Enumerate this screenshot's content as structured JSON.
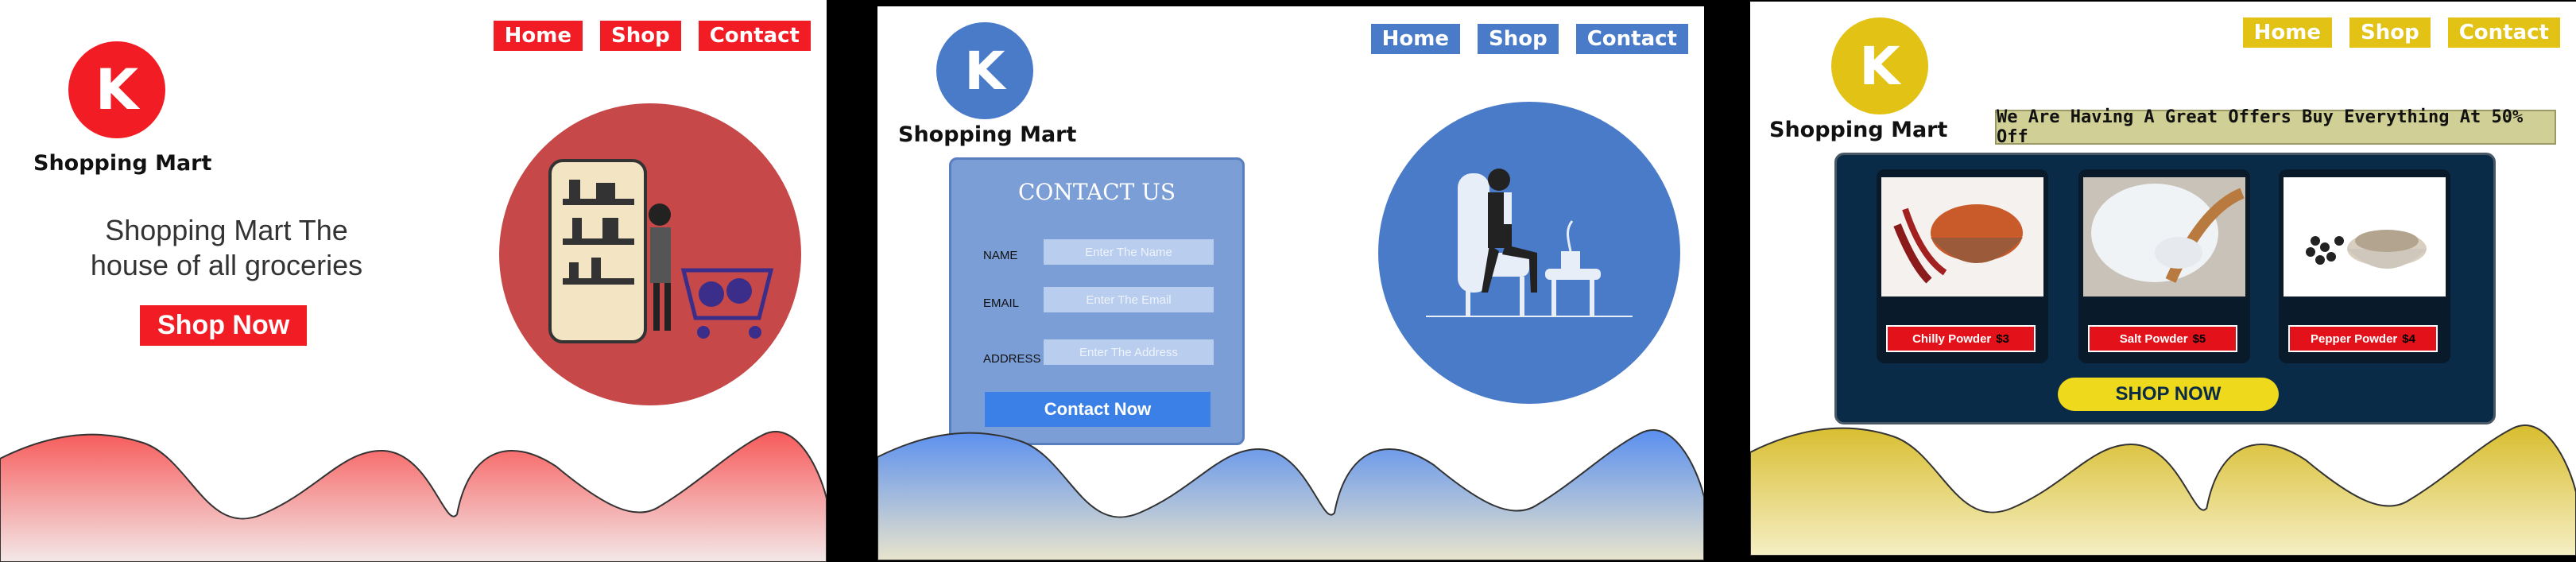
{
  "panels": [
    {
      "nav": [
        "Home",
        "Shop",
        "Contact"
      ],
      "logo_letter": "K",
      "brand": "Shopping Mart",
      "headline_line1": "Shopping Mart The",
      "headline_line2": "house of all groceries",
      "cta": "Shop Now",
      "accent": "#f21c24"
    },
    {
      "nav": [
        "Home",
        "Shop",
        "Contact"
      ],
      "logo_letter": "K",
      "brand": "Shopping Mart",
      "contact_title": "CONTACT US",
      "fields": [
        {
          "label": "NAME",
          "placeholder": "Enter The Name"
        },
        {
          "label": "EMAIL",
          "placeholder": "Enter The Email"
        },
        {
          "label": "ADDRESS",
          "placeholder": "Enter The Address"
        }
      ],
      "submit": "Contact Now",
      "accent": "#4a7bc8"
    },
    {
      "nav": [
        "Home",
        "Shop",
        "Contact"
      ],
      "logo_letter": "K",
      "brand": "Shopping Mart",
      "offer": "We Are Having A Great Offers Buy Everything At 50% Off",
      "products": [
        {
          "name": "Chilly Powder",
          "price": "$3"
        },
        {
          "name": "Salt Powder",
          "price": "$5"
        },
        {
          "name": "Pepper Powder",
          "price": "$4"
        }
      ],
      "cta": "SHOP NOW",
      "accent": "#e2c214"
    }
  ]
}
